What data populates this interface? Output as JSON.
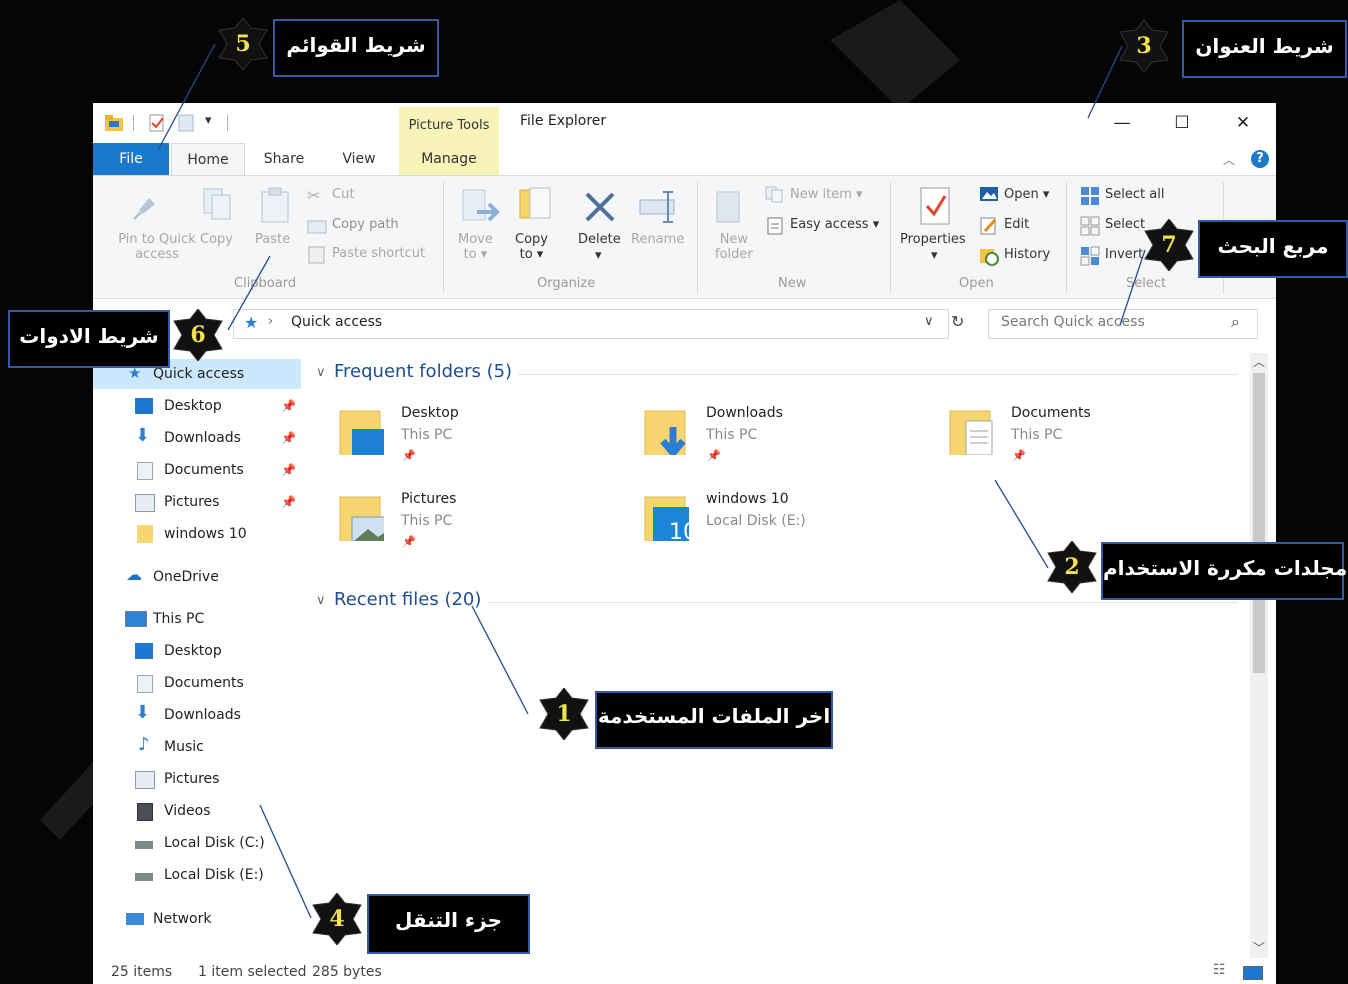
{
  "window": {
    "title": "File Explorer",
    "picture_tools": "Picture Tools",
    "controls": {
      "minimize": "—",
      "maximize": "☐",
      "close": "✕"
    }
  },
  "tabs": [
    "File",
    "Home",
    "Share",
    "View",
    "Manage"
  ],
  "ribbon": {
    "clipboard": {
      "pin_line1": "Pin to Quick",
      "pin_line2": "access",
      "copy": "Copy",
      "paste": "Paste",
      "cut": "Cut",
      "copy_path": "Copy path",
      "paste_shortcut": "Paste shortcut",
      "group": "Clipboard"
    },
    "organize": {
      "move_line1": "Move",
      "move_line2": "to ▾",
      "copy_line1": "Copy",
      "copy_line2": "to ▾",
      "delete": "Delete",
      "delete_arrow": "▾",
      "rename": "Rename",
      "group": "Organize"
    },
    "new": {
      "new_folder_line1": "New",
      "new_folder_line2": "folder",
      "new_item": "New item ▾",
      "easy_access": "Easy access ▾",
      "group": "New"
    },
    "open": {
      "properties": "Properties",
      "properties_arrow": "▾",
      "open": "Open ▾",
      "edit": "Edit",
      "history": "History",
      "group": "Open"
    },
    "select": {
      "select_all": "Select all",
      "select_none": "Select",
      "invert": "Invert",
      "group": "Select"
    }
  },
  "address": {
    "crumb": "Quick access",
    "search_placeholder": "Search Quick access"
  },
  "nav": {
    "quick_access": "Quick access",
    "qa_items": [
      "Desktop",
      "Downloads",
      "Documents",
      "Pictures",
      "windows 10"
    ],
    "onedrive": "OneDrive",
    "this_pc": "This PC",
    "pc_items": [
      "Desktop",
      "Documents",
      "Downloads",
      "Music",
      "Pictures",
      "Videos",
      "Local Disk (C:)",
      "Local Disk (E:)"
    ],
    "network": "Network"
  },
  "content": {
    "frequent_header": "Frequent folders (5)",
    "recent_header": "Recent files (20)",
    "folders": [
      {
        "name": "Desktop",
        "sub": "This PC"
      },
      {
        "name": "Downloads",
        "sub": "This PC"
      },
      {
        "name": "Documents",
        "sub": "This PC"
      },
      {
        "name": "Pictures",
        "sub": "This PC"
      },
      {
        "name": "windows 10",
        "sub": "Local Disk (E:)"
      }
    ]
  },
  "status": {
    "items": "25 items",
    "selected": "1 item selected",
    "size": "285 bytes"
  },
  "callouts": [
    {
      "num": "1",
      "text": "اخر الملفات المستخدمة"
    },
    {
      "num": "2",
      "text": "مجلدات مكررة الاستخدام"
    },
    {
      "num": "3",
      "text": "شريط العنوان"
    },
    {
      "num": "4",
      "text": "جزء التنقل"
    },
    {
      "num": "5",
      "text": "شريط القوائم"
    },
    {
      "num": "6",
      "text": "شريط الادوات"
    },
    {
      "num": "7",
      "text": "مربع البحث"
    }
  ],
  "colors": {
    "accent": "#1979ca",
    "callout_border": "#3359a7",
    "badge_text": "#f3e34a",
    "picture_tools": "#f7f3b9"
  }
}
